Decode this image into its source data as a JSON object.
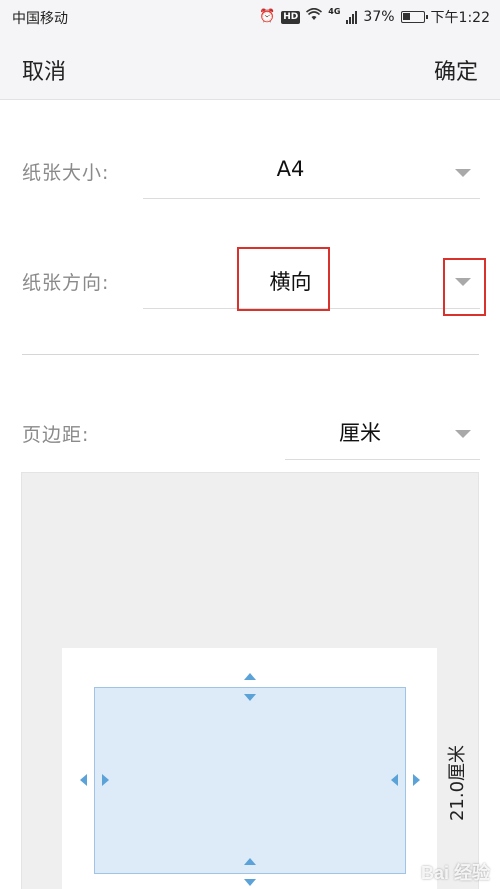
{
  "status_bar": {
    "carrier": "中国移动",
    "network": "4G",
    "hd": "HD",
    "battery_text": "37%",
    "battery_level": 0.37,
    "time": "下午1:22",
    "icons": [
      "alarm-icon",
      "hd-icon",
      "wifi-icon",
      "signal-icon",
      "battery-icon"
    ]
  },
  "top_bar": {
    "cancel_label": "取消",
    "ok_label": "确定"
  },
  "paper_size": {
    "label": "纸张大小:",
    "value": "A4"
  },
  "paper_orientation": {
    "label": "纸张方向:",
    "value": "横向"
  },
  "margins": {
    "label": "页边距:",
    "unit_value": "厘米"
  },
  "preview": {
    "dimension_label": "21.0厘米"
  },
  "watermark": {
    "text": "Bai 经验"
  },
  "colors": {
    "highlight_box": "#d9322c",
    "margin_fill": "#ddebf8",
    "arrow": "#5aa2d8"
  }
}
